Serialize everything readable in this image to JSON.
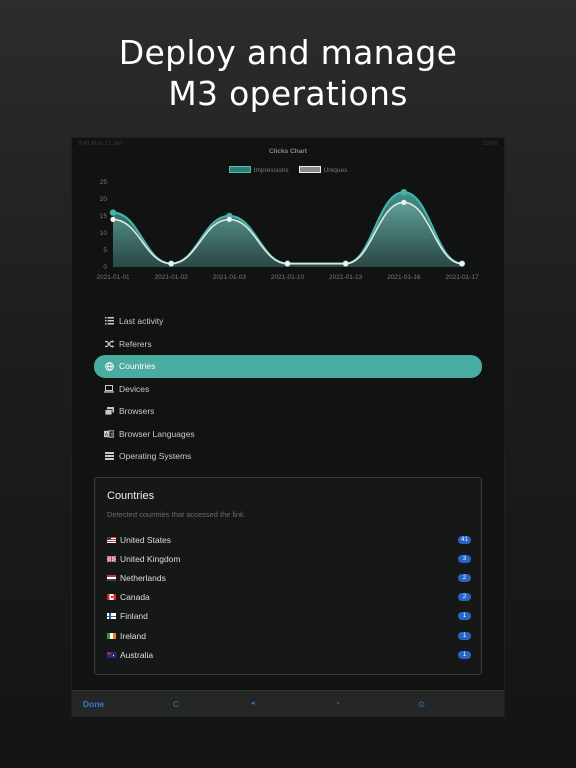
{
  "headline": {
    "line1": "Deploy and manage",
    "line2": "M3 operations"
  },
  "statusbar": {
    "left": "9:41 Mon 17 Jan",
    "right": "100%"
  },
  "chart_data": {
    "type": "area",
    "title": "Clicks Chart",
    "x": [
      "2021-01-01",
      "2021-01-02",
      "2021-01-03",
      "2021-01-10",
      "2021-01-13",
      "2021-01-16",
      "2021-01-17"
    ],
    "ylim": [
      0,
      25
    ],
    "yticks": [
      0,
      5,
      10,
      15,
      20,
      25
    ],
    "series": [
      {
        "name": "Impressions",
        "values": [
          16,
          1,
          15,
          1,
          1,
          22,
          1
        ],
        "color": "#3a9a90"
      },
      {
        "name": "Uniques",
        "values": [
          14,
          1,
          14,
          1,
          1,
          19,
          1
        ],
        "color": "#dcdcdc"
      }
    ],
    "legend": "top-center"
  },
  "menu": {
    "items": [
      {
        "label": "Last activity",
        "icon": "list-icon"
      },
      {
        "label": "Referers",
        "icon": "shuffle-icon"
      },
      {
        "label": "Countries",
        "icon": "globe-icon",
        "active": true
      },
      {
        "label": "Devices",
        "icon": "laptop-icon"
      },
      {
        "label": "Browsers",
        "icon": "windows-icon"
      },
      {
        "label": "Browser Languages",
        "icon": "language-icon"
      },
      {
        "label": "Operating Systems",
        "icon": "server-icon"
      }
    ]
  },
  "panel": {
    "title": "Countries",
    "subtitle": "Detected countries that accessed the link.",
    "countries": [
      {
        "name": "United States",
        "count": "41",
        "flag": "us-flag-icon"
      },
      {
        "name": "United Kingdom",
        "count": "3",
        "flag": "uk-flag-icon"
      },
      {
        "name": "Netherlands",
        "count": "2",
        "flag": "nl-flag-icon"
      },
      {
        "name": "Canada",
        "count": "2",
        "flag": "ca-flag-icon"
      },
      {
        "name": "Finland",
        "count": "1",
        "flag": "fi-flag-icon"
      },
      {
        "name": "Ireland",
        "count": "1",
        "flag": "ie-flag-icon"
      },
      {
        "name": "Australia",
        "count": "1",
        "flag": "au-flag-icon"
      }
    ]
  },
  "toolbar": {
    "done_label": "Done",
    "reload_label": "C",
    "back_label": "◂",
    "forward_label": "▸",
    "share_label": "⊙"
  },
  "colors": {
    "accent": "#4aaba1",
    "badge": "#2b63c7",
    "link": "#2f7bd6"
  }
}
